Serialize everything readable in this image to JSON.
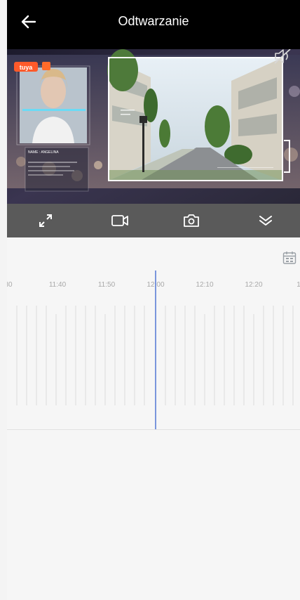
{
  "header": {
    "title": "Odtwarzanie"
  },
  "video": {
    "brand_badge": "tuya",
    "name_card": "NAME : ANGELINA"
  },
  "timeline": {
    "ticks": [
      "30",
      "11:40",
      "11:50",
      "12:00",
      "12:10",
      "12:20",
      "1"
    ],
    "current_time": "12:00"
  },
  "icons": {
    "back": "arrow-left-icon",
    "mute": "speaker-muted-icon",
    "fullscreen": "expand-icon",
    "record": "video-camera-icon",
    "snapshot": "camera-icon",
    "more": "double-chevron-down-icon",
    "calendar": "calendar-icon"
  },
  "colors": {
    "topbar": "#000000",
    "controls_bar": "#5a5a5a",
    "playhead": "#5b7fd6",
    "background": "#f6f6f6"
  }
}
